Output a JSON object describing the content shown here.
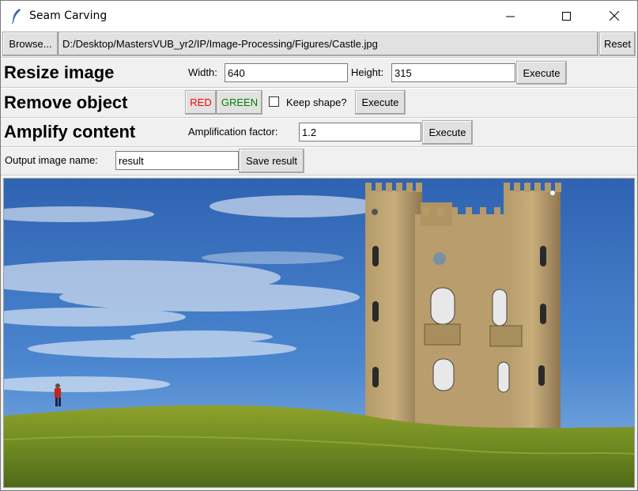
{
  "window": {
    "title": "Seam Carving",
    "minimize_icon": "minimize-icon",
    "maximize_icon": "maximize-icon",
    "close_icon": "close-icon"
  },
  "file_bar": {
    "browse_label": "Browse...",
    "file_path": "D:/Desktop/MastersVUB_yr2/IP/Image-Processing/Figures/Castle.jpg",
    "reset_label": "Reset"
  },
  "resize": {
    "heading": "Resize image",
    "width_label": "Width:",
    "width_value": "640",
    "height_label": "Height:",
    "height_value": "315",
    "execute_label": "Execute"
  },
  "remove": {
    "heading": "Remove object",
    "red_label": "RED",
    "green_label": "GREEN",
    "keep_shape_label": "Keep shape?",
    "keep_shape_checked": false,
    "execute_label": "Execute",
    "red_color": "#ff0000",
    "green_color": "#008000"
  },
  "amplify": {
    "heading": "Amplify content",
    "factor_label": "Amplification factor:",
    "factor_value": "1.2",
    "execute_label": "Execute"
  },
  "output": {
    "name_label": "Output image name:",
    "name_value": "result",
    "save_label": "Save result"
  }
}
